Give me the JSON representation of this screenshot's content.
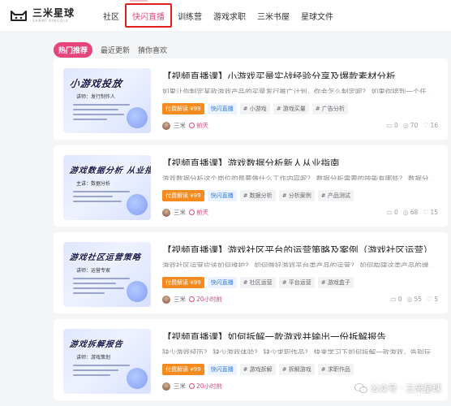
{
  "header": {
    "logo_name": "三米星球",
    "logo_sub": "SANMI XINGQIU",
    "nav": [
      "社区",
      "快闪直播",
      "训练营",
      "游戏求职",
      "三米书屋",
      "星球文件"
    ],
    "active_nav": 1
  },
  "tabs": [
    "热门推荐",
    "最近更新",
    "猜你喜欢"
  ],
  "cards": [
    {
      "title": "【视频直播课】小游戏买量实战经验分享及爆款素材分析",
      "desc": "如果让你制定某款游戏产品的买量发行推广计划，你会怎么制定呢？ 如果你接到一个任务，公...",
      "thumb_title": "小游戏投放",
      "thumb_sub": "讲师：发行制作人",
      "tags": [
        "付费解读 ¥99",
        "快闪直播",
        "# 小游戏",
        "# 游戏买量",
        "# 广告分析"
      ],
      "author": "三米",
      "time": "前天",
      "comments": "0",
      "views": "70",
      "likes": "16"
    },
    {
      "title": "【视频直播课】游戏数据分析新人从业指南",
      "desc": "游戏数据分析这个岗位的是要做什么工作内容呢？ 数据分析需要的技能有哪些？ 数据分析的方...",
      "thumb_title": "游戏数据分析 从业指南（三）",
      "thumb_sub": "主讲：数据分析",
      "tags": [
        "付费解读 ¥99",
        "快闪直播",
        "# 数据分析",
        "# 分析案例",
        "# 产品测试"
      ],
      "author": "三米",
      "time": "前天",
      "comments": "0",
      "views": "68",
      "likes": "15"
    },
    {
      "title": "【视频直播课】游戏社区平台的运营策略及案例（游戏社区运营）",
      "desc": "游戏社区运营应该如何维护？ 如何做好游戏平台类产品的运营？ 如何构建这类产品的增长/留存...",
      "thumb_title": "游戏社区运营策略",
      "thumb_sub": "讲师：运营专家",
      "tags": [
        "付费解读 ¥99",
        "快闪直播",
        "# 社区运营",
        "# 平台运营",
        "# 游戏盒子"
      ],
      "author": "三米",
      "time": "20小时前",
      "comments": "0",
      "views": "55",
      "likes": "5"
    },
    {
      "title": "【视频直播课】如何拆解一款游戏并输出一份拆解报告",
      "desc": "缺少游戏经历？ 缺少游戏体验？ 缺少求职作品？ 快来学习下如何拆解一款游戏，告别玩家视角...",
      "thumb_title": "游戏拆解报告",
      "thumb_sub": "讲师：游戏策划",
      "tags": [
        "付费解读 ¥99",
        "快闪直播",
        "# 游戏拆解",
        "# 拆解游戏",
        "# 求职作品"
      ],
      "author": "三米",
      "time": "20小时前",
      "comments": "0",
      "views": "",
      "likes": ""
    }
  ],
  "watermark": "公众号 · 三米星球",
  "colors": {
    "accent": "#e6457a",
    "price": "#f58a1f",
    "live": "#2f7be0",
    "highlight": "#e02020"
  }
}
